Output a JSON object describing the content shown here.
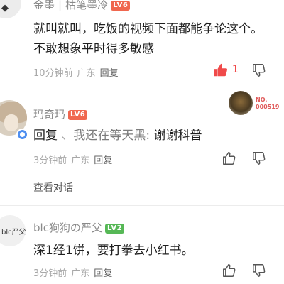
{
  "comments": [
    {
      "username": "金墨",
      "title": "枯笔墨冷",
      "level": "LV6",
      "content_lines": [
        "就叫就叫，吃饭的视频下面都能争论这个。",
        "不敢想象平时得多敏感"
      ],
      "time": "10分钟前",
      "location": "广东",
      "reply_label": "回复",
      "like_count": "1"
    },
    {
      "username": "玛奇玛",
      "level": "LV6",
      "reply_prefix": "回复",
      "reply_arrow": "、",
      "reply_target": "我还在等天黑:",
      "content": "谢谢科普",
      "time": "3分钟前",
      "location": "广东",
      "reply_label": "回复",
      "medal_text": "NO.\n000519",
      "view_dialog": "查看对话"
    },
    {
      "username": "blc狗狗の严父",
      "level": "LV2",
      "avatar_text": "blc严父",
      "content": "深1经1饼，要打拳去小红书。",
      "time": "3分钟前",
      "location": "广东",
      "reply_label": "回复"
    }
  ],
  "colors": {
    "level_badge_high": "#f0674f",
    "level_badge_low": "#56b856",
    "like_active": "#f04a4a"
  }
}
